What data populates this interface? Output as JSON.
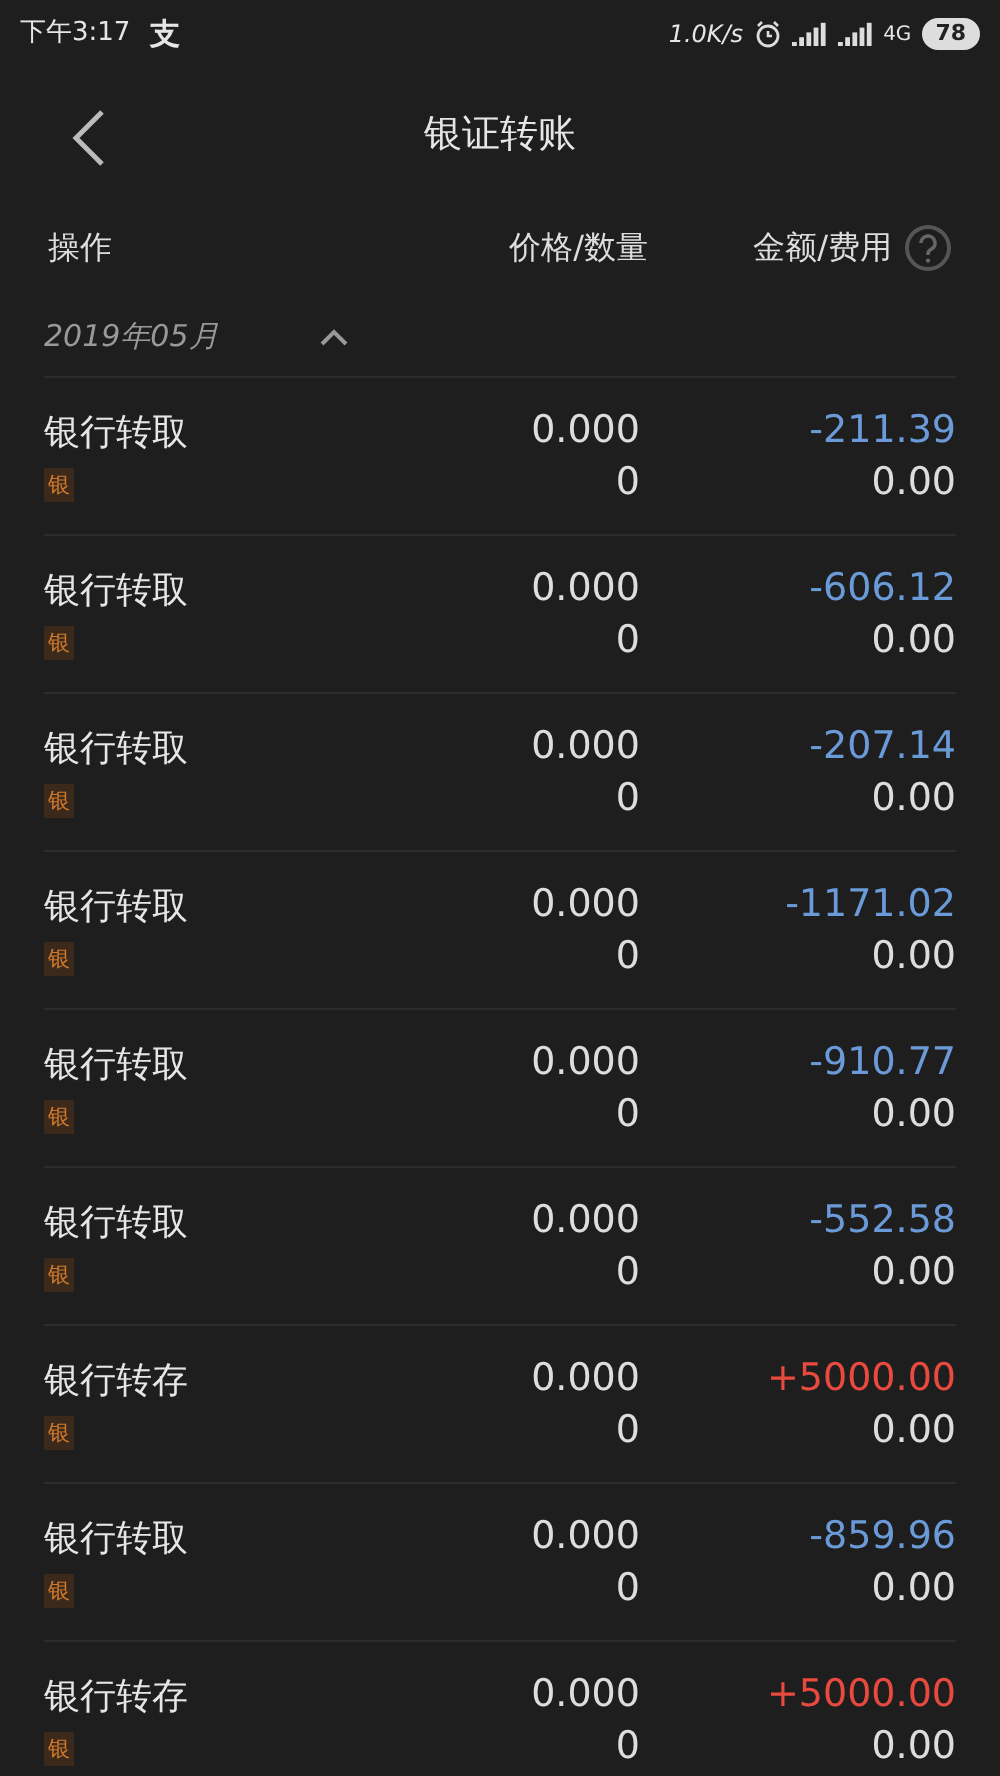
{
  "status_bar": {
    "time": "下午3:17",
    "app_glyph": "支",
    "speed": "1.0K/s",
    "network": "4G",
    "battery": "78"
  },
  "header": {
    "title": "银证转账"
  },
  "columns": [
    "操作",
    "价格/数量",
    "金额/费用"
  ],
  "month": {
    "label": "2019年05月",
    "expanded": true
  },
  "rows": [
    {
      "action": "银行转取",
      "tag": "银",
      "price": "0.000",
      "qty": "0",
      "amount": "-211.39",
      "fee": "0.00",
      "kind": "out"
    },
    {
      "action": "银行转取",
      "tag": "银",
      "price": "0.000",
      "qty": "0",
      "amount": "-606.12",
      "fee": "0.00",
      "kind": "out"
    },
    {
      "action": "银行转取",
      "tag": "银",
      "price": "0.000",
      "qty": "0",
      "amount": "-207.14",
      "fee": "0.00",
      "kind": "out"
    },
    {
      "action": "银行转取",
      "tag": "银",
      "price": "0.000",
      "qty": "0",
      "amount": "-1171.02",
      "fee": "0.00",
      "kind": "out"
    },
    {
      "action": "银行转取",
      "tag": "银",
      "price": "0.000",
      "qty": "0",
      "amount": "-910.77",
      "fee": "0.00",
      "kind": "out"
    },
    {
      "action": "银行转取",
      "tag": "银",
      "price": "0.000",
      "qty": "0",
      "amount": "-552.58",
      "fee": "0.00",
      "kind": "out"
    },
    {
      "action": "银行转存",
      "tag": "银",
      "price": "0.000",
      "qty": "0",
      "amount": "+5000.00",
      "fee": "0.00",
      "kind": "in"
    },
    {
      "action": "银行转取",
      "tag": "银",
      "price": "0.000",
      "qty": "0",
      "amount": "-859.96",
      "fee": "0.00",
      "kind": "out"
    },
    {
      "action": "银行转存",
      "tag": "银",
      "price": "0.000",
      "qty": "0",
      "amount": "+5000.00",
      "fee": "0.00",
      "kind": "in"
    }
  ]
}
